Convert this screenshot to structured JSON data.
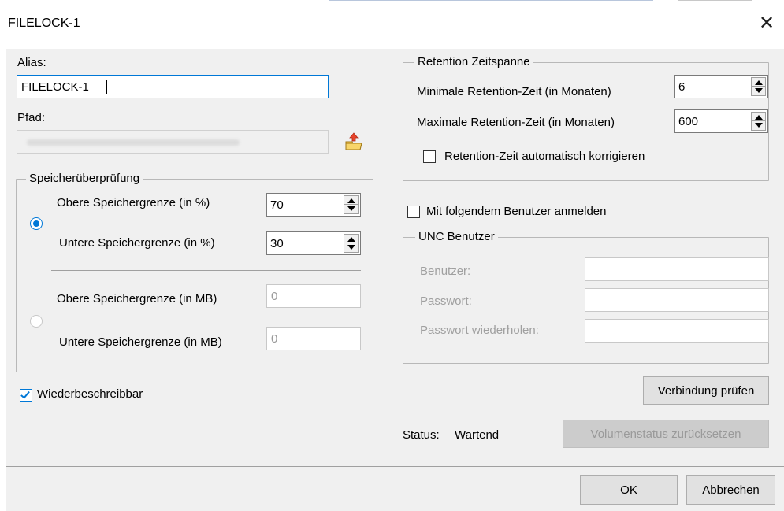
{
  "window": {
    "title": "FILELOCK-1",
    "close_glyph": "✕"
  },
  "alias": {
    "label": "Alias:",
    "value": "FILELOCK-1"
  },
  "path": {
    "label": "Pfad:",
    "value": "",
    "browse_icon": "folder-browse-icon"
  },
  "storage_check": {
    "legend": "Speicherüberprüfung",
    "percent_selected": true,
    "upper_percent_label": "Obere Speichergrenze (in %)",
    "upper_percent_value": "70",
    "lower_percent_label": "Untere Speichergrenze (in %)",
    "lower_percent_value": "30",
    "upper_mb_label": "Obere Speichergrenze (in MB)",
    "upper_mb_value": "0",
    "lower_mb_label": "Untere Speichergrenze (in MB)",
    "lower_mb_value": "0"
  },
  "rewritable": {
    "label": "Wiederbeschreibbar",
    "checked": true
  },
  "retention": {
    "legend": "Retention Zeitspanne",
    "min_label": "Minimale Retention-Zeit (in Monaten)",
    "min_value": "6",
    "max_label": "Maximale Retention-Zeit (in Monaten)",
    "max_value": "600",
    "auto_correct_label": "Retention-Zeit automatisch korrigieren",
    "auto_correct_checked": false
  },
  "login_user": {
    "label": "Mit folgendem Benutzer anmelden",
    "checked": false
  },
  "unc_user": {
    "legend": "UNC Benutzer",
    "user_label": "Benutzer:",
    "password_label": "Passwort:",
    "password_repeat_label": "Passwort wiederholen:"
  },
  "buttons": {
    "verify_connection": "Verbindung prüfen",
    "reset_volume_status": "Volumenstatus zurücksetzen",
    "ok": "OK",
    "cancel": "Abbrechen"
  },
  "status": {
    "label": "Status:",
    "value": "Wartend"
  },
  "colors": {
    "accent": "#0078d7",
    "dialog_bg": "#f0f0f0"
  }
}
